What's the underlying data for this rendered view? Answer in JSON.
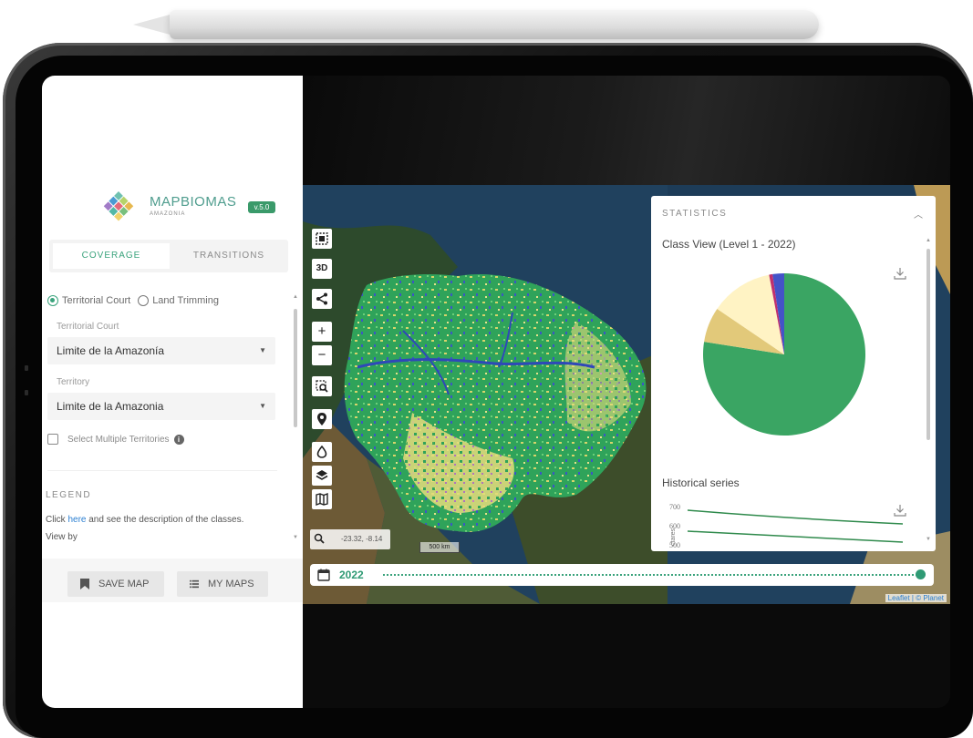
{
  "app": {
    "logo_text": "MAPBIOMAS",
    "logo_subtitle": "AMAZONIA",
    "version": "v.5.0"
  },
  "tabs": [
    {
      "label": "COVERAGE",
      "active": true
    },
    {
      "label": "TRANSITIONS",
      "active": false
    }
  ],
  "filters": {
    "radio_options": [
      "Territorial Court",
      "Land Trimming"
    ],
    "radio_selected": "Territorial Court",
    "territorial_court_label": "Territorial Court",
    "territorial_court_value": "Limite de la Amazonía",
    "territory_label": "Territory",
    "territory_value": "Limite de la Amazonia",
    "multi_select_label": "Select Multiple Territories"
  },
  "legend": {
    "title": "LEGEND",
    "text_before": "Click ",
    "link": "here",
    "text_after": " and see the description of the classes.",
    "view_by": "View by"
  },
  "actions": {
    "save_map": "SAVE MAP",
    "my_maps": "MY MAPS"
  },
  "map": {
    "tool_3d": "3D",
    "coords": "-23.32, -8.14",
    "scale": "500 km",
    "attribution": "Leaflet | © Planet"
  },
  "timeline": {
    "year": "2022",
    "selected_fraction": 1.0
  },
  "statistics": {
    "title": "STATISTICS",
    "class_view_title": "Class View (Level 1 - 2022)",
    "historical_title": "Historical series",
    "y_axis_label": "ctares",
    "y_ticks": [
      "700",
      "600",
      "500"
    ]
  },
  "colors": {
    "accent": "#3aa37c",
    "forest": "#3aa563",
    "farming": "#fff3c4",
    "non_vegetated": "#e2c97a",
    "water": "#4453c8",
    "other": "#c0306e"
  },
  "chart_data": {
    "type": "pie",
    "title": "Class View (Level 1 - 2022)",
    "slices": [
      {
        "color": "#3aa563",
        "value": 77.5
      },
      {
        "color": "#e2c97a",
        "value": 7.0
      },
      {
        "color": "#fff3c4",
        "value": 12.5
      },
      {
        "color": "#c0306e",
        "value": 0.7
      },
      {
        "color": "#4453c8",
        "value": 2.3
      }
    ]
  }
}
